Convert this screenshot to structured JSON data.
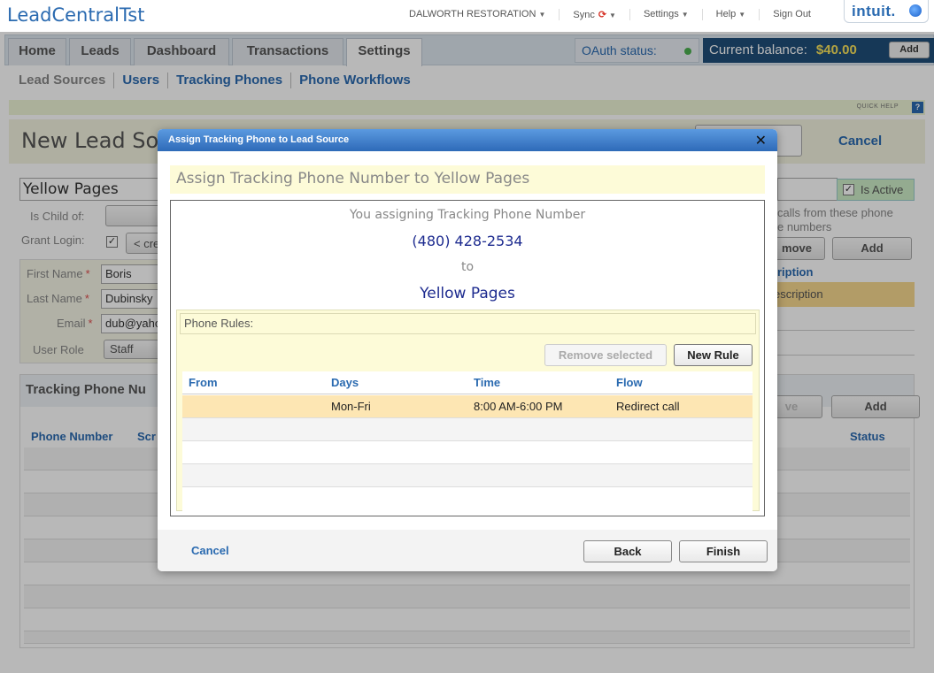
{
  "app": {
    "title": "LeadCentralTst"
  },
  "top_menu": {
    "company": "DALWORTH RESTORATION",
    "sync": "Sync",
    "settings": "Settings",
    "help": "Help",
    "signout": "Sign Out",
    "intuit_logo": "intuit.",
    "icons": {
      "caret": "chevron-down-icon",
      "sync": "sync-icon"
    }
  },
  "nav": {
    "tabs": [
      "Home",
      "Leads",
      "Dashboard",
      "Transactions",
      "Settings"
    ],
    "active_tab": "Settings",
    "oauth_label": "OAuth status:",
    "oauth_status_color": "#4caf50",
    "balance_label": "Current balance:",
    "balance_value": "$40.00",
    "add_label": "Add"
  },
  "subnav": [
    "Lead Sources",
    "Users",
    "Tracking Phones",
    "Phone Workflows"
  ],
  "background": {
    "quick_help": "QUICK HELP",
    "quick_help_icon": "?",
    "page_title": "New Lead So",
    "cancel_label": "Cancel",
    "name_value": "Yellow Pages",
    "is_active_label": "Is Active",
    "is_active_check": "✓",
    "is_child_label": "Is Child of:",
    "grant_login_label": "Grant Login:",
    "grant_login_check": "✓",
    "create_button": "< cre",
    "required_marker": "*",
    "first_name_label": "First Name",
    "first_name_value": "Boris",
    "last_name_label": "Last Name",
    "last_name_value": "Dubinsky",
    "email_label": "Email",
    "email_value": "dub@yaho",
    "role_label": "User Role",
    "role_value": "Staff",
    "desc_text_1": "calls from these phone",
    "desc_text_2": "e numbers",
    "remove_label": "move",
    "add_label": "Add",
    "desc_header": "ription",
    "desc_row": "escription",
    "tp_title": "Tracking Phone Nu",
    "tp_remove": "ve",
    "tp_add": "Add",
    "tp_col_phone": "Phone Number",
    "tp_col_scr": "Scr",
    "tp_col_status": "Status"
  },
  "modal": {
    "title": "Assign Tracking Phone to Lead Source",
    "close_icon": "close-icon",
    "close_glyph": "✕",
    "subheading": "Assign Tracking Phone Number to Yellow Pages",
    "intro": "You assigning Tracking Phone Number",
    "phone": "(480) 428-2534",
    "to": "to",
    "source": "Yellow Pages",
    "rules_label": "Phone Rules:",
    "remove_selected": "Remove selected",
    "new_rule": "New Rule",
    "columns": [
      "From",
      "Days",
      "Time",
      "Flow"
    ],
    "rows": [
      {
        "from": "",
        "days": "Mon-Fri",
        "time": "8:00 AM-6:00 PM",
        "flow": "Redirect call"
      }
    ],
    "cancel": "Cancel",
    "back": "Back",
    "finish": "Finish"
  },
  "colors": {
    "accent": "#2a6ab0",
    "modal_header": "#2e6ab8",
    "selected_row": "#fde6b3",
    "balance_bg": "#1f4e79",
    "balance_value": "#f8e25a"
  }
}
